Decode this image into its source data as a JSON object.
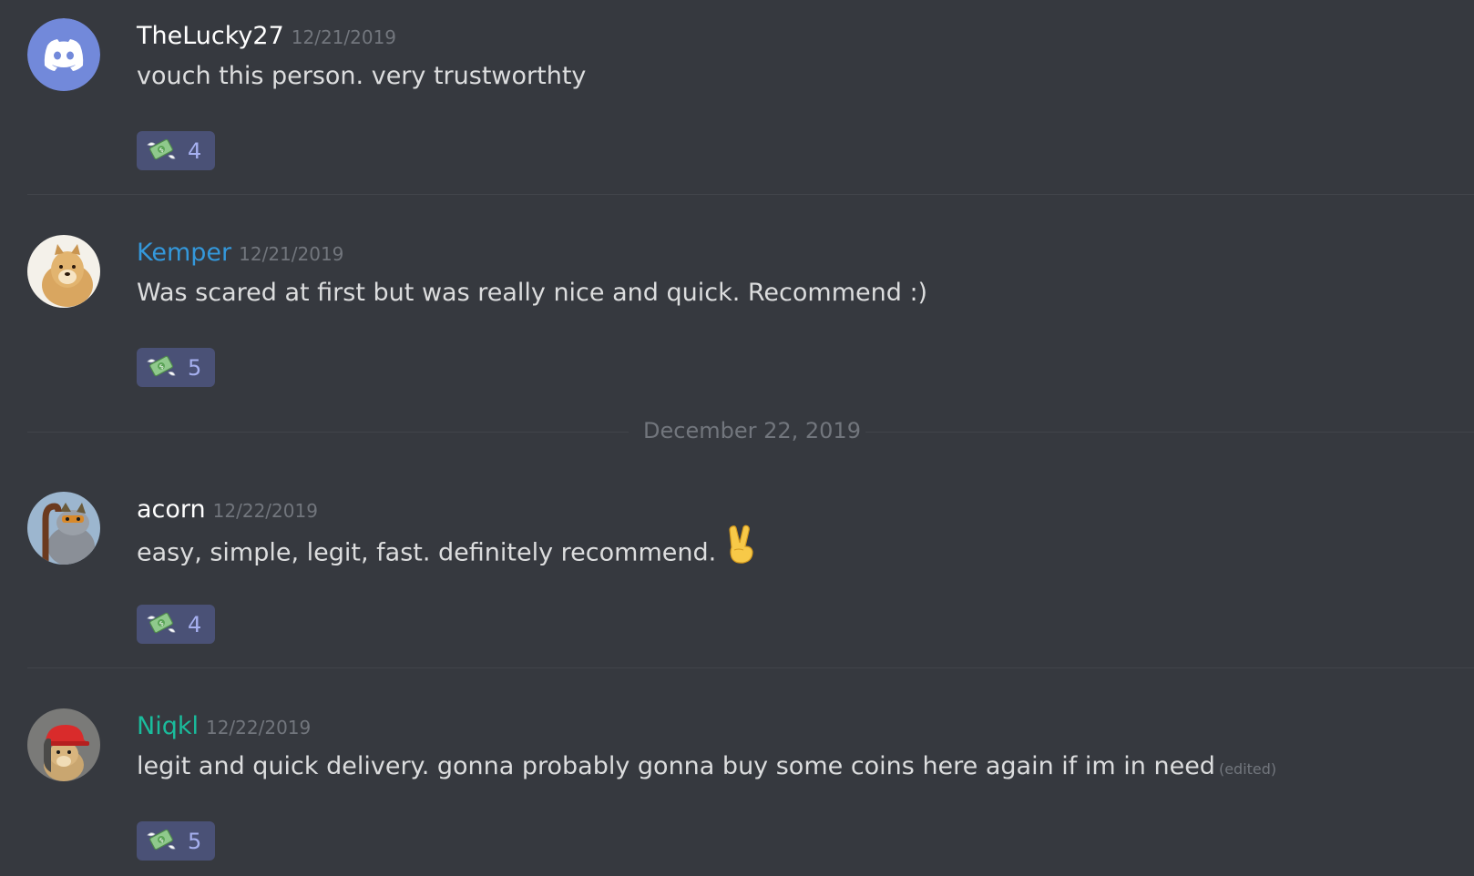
{
  "colors": {
    "background": "#36393f",
    "reaction_bg": "#4a5176",
    "reaction_count": "#a6b0f0",
    "timestamp": "#72767d",
    "discord_blurple": "#7289da"
  },
  "messages": [
    {
      "username": "TheLucky27",
      "username_color": "#ffffff",
      "timestamp": "12/21/2019",
      "content": "vouch this person. very trustworthty",
      "avatar": "discord-logo-icon",
      "reaction": {
        "emoji": "money-with-wings-icon",
        "count": "4"
      }
    },
    {
      "username": "Kemper",
      "username_color": "#3498db",
      "timestamp": "12/21/2019",
      "content": "Was scared at first but was really nice and quick. Recommend :)",
      "avatar": "doge-icon",
      "reaction": {
        "emoji": "money-with-wings-icon",
        "count": "5"
      }
    },
    {
      "username": "acorn",
      "username_color": "#ffffff",
      "timestamp": "12/22/2019",
      "content": "easy, simple, legit, fast. definitely recommend.",
      "content_emoji": "victory-hand-icon",
      "avatar": "cartoon-mascot-icon",
      "reaction": {
        "emoji": "money-with-wings-icon",
        "count": "4"
      }
    },
    {
      "username": "Niqkl",
      "username_color": "#1abc9c",
      "timestamp": "12/22/2019",
      "content": "legit and quick delivery. gonna probably gonna buy some coins here again if im in need",
      "edited_label": "(edited)",
      "avatar": "dog-red-cap-icon",
      "reaction": {
        "emoji": "money-with-wings-icon",
        "count": "5"
      }
    }
  ],
  "date_divider": "December 22, 2019"
}
